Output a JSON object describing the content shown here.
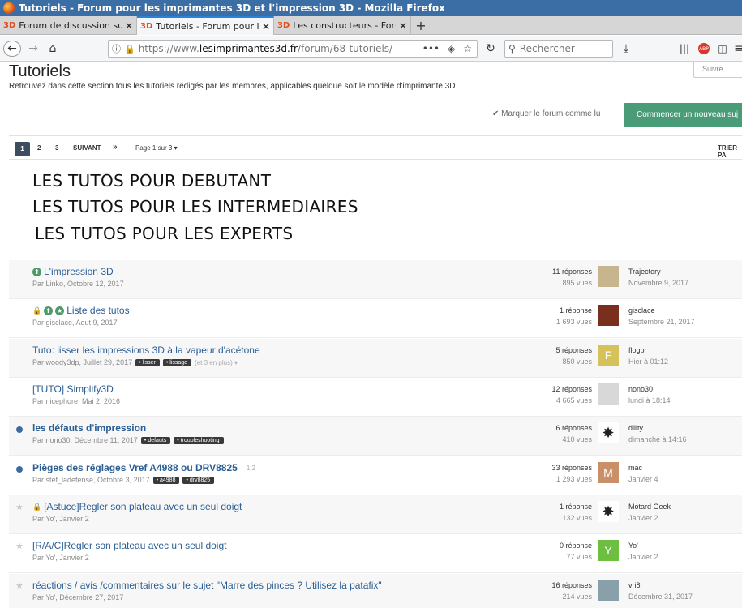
{
  "window": {
    "title": "Tutoriels - Forum pour les imprimantes 3D et l'impression 3D - Mozilla Firefox"
  },
  "tabs": [
    {
      "favicon": "3D",
      "label": "Forum de discussion sur",
      "active": false
    },
    {
      "favicon": "3D",
      "label": "Tutoriels - Forum pour le",
      "active": true
    },
    {
      "favicon": "3D",
      "label": "Les constructeurs - Foru",
      "active": false
    }
  ],
  "nav": {
    "url_scheme": "https://www.",
    "url_host": "lesimprimantes3d.fr",
    "url_path": "/forum/68-tutoriels/",
    "search_placeholder": "Rechercher"
  },
  "page": {
    "title": "Tutoriels",
    "description": "Retrouvez dans cette section tous les tutoriels rédigés par les membres, applicables quelque soit le modèle d'imprimante 3D.",
    "follow_label": "Suivre",
    "mark_read": "✔ Marquer le forum comme lu",
    "new_topic": "Commencer un nouveau suj",
    "sort_label": "TRIER PA"
  },
  "pager": {
    "current": "1",
    "pages": [
      "2",
      "3"
    ],
    "next": "SUIVANT",
    "last": "»",
    "info": "Page 1 sur 3 ▾"
  },
  "overlay_lines": [
    "LES TUTOS POUR DEBUTANT",
    "LES TUTOS POUR LES INTERMEDIAIRES",
    "LES TUTOS POUR LES EXPERTS"
  ],
  "topics": [
    {
      "title": "L'impression 3D",
      "meta": "Par Linko, Octobre 12, 2017",
      "replies": "11 réponses",
      "views": "895 vues",
      "last_user": "Trajectory",
      "last_date": "Novembre 9, 2017",
      "tags": [],
      "icons": [
        "pin"
      ],
      "avatar_color": "#c7b58e",
      "avatar_text": "",
      "bold": false,
      "unread": false,
      "star": false
    },
    {
      "title": "Liste des tutos",
      "meta": "Par gisclace, Aout 9, 2017",
      "replies": "1 réponse",
      "views": "1 693 vues",
      "last_user": "gisclace",
      "last_date": "Septembre 21, 2017",
      "tags": [],
      "icons": [
        "lock",
        "pin",
        "star"
      ],
      "avatar_color": "#7a2e1e",
      "avatar_text": "",
      "bold": false,
      "unread": false,
      "star": false
    },
    {
      "title": "Tuto: lisser les impressions 3D à la vapeur d'acétone",
      "meta": "Par woody3dp, Juillet 29, 2017",
      "replies": "5 réponses",
      "views": "850 vues",
      "last_user": "flogpr",
      "last_date": "Hier à 01:12",
      "tags": [
        "lisser",
        "lissage"
      ],
      "more": "(et 3 en plus) ▾",
      "icons": [],
      "avatar_color": "#d6c25a",
      "avatar_text": "F",
      "bold": false,
      "unread": false,
      "star": false
    },
    {
      "title": "[TUTO] Simplify3D",
      "meta": "Par nicephore, Mai 2, 2016",
      "replies": "12 réponses",
      "views": "4 665 vues",
      "last_user": "nono30",
      "last_date": "lundi à 18:14",
      "tags": [],
      "icons": [],
      "avatar_color": "#d8d8d8",
      "avatar_text": "",
      "bold": false,
      "unread": false,
      "star": false
    },
    {
      "title": "les défauts d'impression",
      "meta": "Par nono30, Décembre 11, 2017",
      "replies": "6 réponses",
      "views": "410 vues",
      "last_user": "diiity",
      "last_date": "dimanche à 14:16",
      "tags": [
        "defauts",
        "troubleshooting"
      ],
      "icons": [],
      "avatar_color": "#ffffff",
      "avatar_text": "",
      "bold": true,
      "unread": true,
      "star": false
    },
    {
      "title": "Pièges des réglages Vref A4988 ou DRV8825",
      "meta": "Par stef_ladefense, Octobre 3, 2017",
      "replies": "33 réponses",
      "views": "1 293 vues",
      "last_user": "mac",
      "last_date": "Janvier 4",
      "tags": [
        "a4988",
        "drv8825"
      ],
      "pagelinks": "1   2",
      "icons": [],
      "avatar_color": "#c98f68",
      "avatar_text": "M",
      "bold": true,
      "unread": true,
      "star": false
    },
    {
      "title": "[Astuce]Regler son plateau avec un seul doigt",
      "meta": "Par Yo', Janvier 2",
      "replies": "1 réponse",
      "views": "132 vues",
      "last_user": "Motard Geek",
      "last_date": "Janvier 2",
      "tags": [],
      "icons": [
        "lock"
      ],
      "avatar_color": "#ffffff",
      "avatar_text": "",
      "bold": false,
      "unread": false,
      "star": true
    },
    {
      "title": "[R/A/C]Regler son plateau avec un seul doigt",
      "meta": "Par Yo', Janvier 2",
      "replies": "0 réponse",
      "views": "77 vues",
      "last_user": "Yo'",
      "last_date": "Janvier 2",
      "tags": [],
      "icons": [],
      "avatar_color": "#6dbf3f",
      "avatar_text": "Y",
      "bold": false,
      "unread": false,
      "star": true
    },
    {
      "title": "réactions / avis /commentaires sur le sujet \"Marre des pinces ? Utilisez la patafix\"",
      "meta": "Par Yo', Décembre 27, 2017",
      "replies": "16 réponses",
      "views": "214 vues",
      "last_user": "vri8",
      "last_date": "Décembre 31, 2017",
      "tags": [],
      "icons": [],
      "avatar_color": "#8aa0a8",
      "avatar_text": "",
      "bold": false,
      "unread": false,
      "star": true
    }
  ]
}
